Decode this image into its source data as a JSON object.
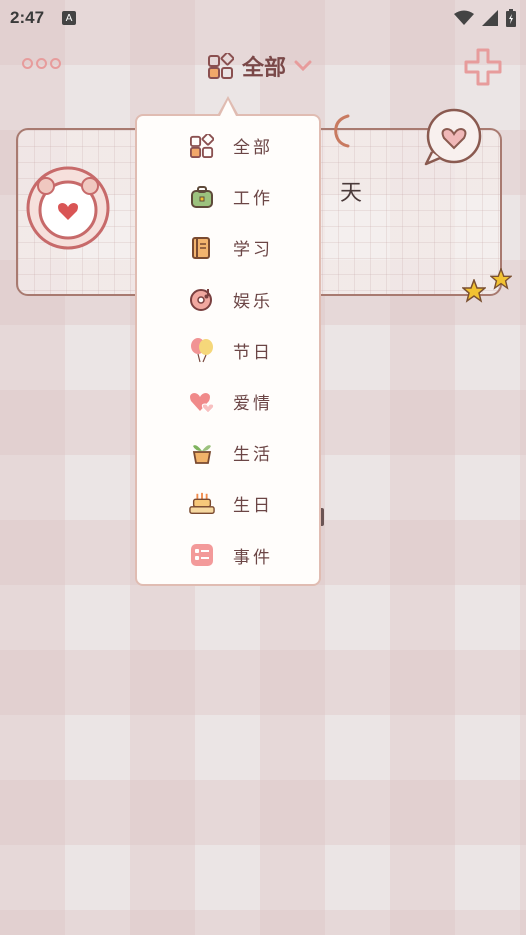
{
  "status_bar": {
    "time": "2:47",
    "notification_badge": "A"
  },
  "top_bar": {
    "category_title": "全部"
  },
  "card": {
    "day_text": "天"
  },
  "dropdown": {
    "items": [
      {
        "label": "全部",
        "icon": "grid-categories-icon"
      },
      {
        "label": "工作",
        "icon": "briefcase-icon"
      },
      {
        "label": "学习",
        "icon": "book-icon"
      },
      {
        "label": "娱乐",
        "icon": "music-disc-icon"
      },
      {
        "label": "节日",
        "icon": "balloons-icon"
      },
      {
        "label": "爱情",
        "icon": "hearts-icon"
      },
      {
        "label": "生活",
        "icon": "potted-plant-icon"
      },
      {
        "label": "生日",
        "icon": "birthday-cake-icon"
      },
      {
        "label": "事件",
        "icon": "event-card-icon"
      }
    ]
  },
  "colors": {
    "accent": "#e79c9c",
    "text": "#6b4545",
    "border": "#e0bcb2"
  }
}
